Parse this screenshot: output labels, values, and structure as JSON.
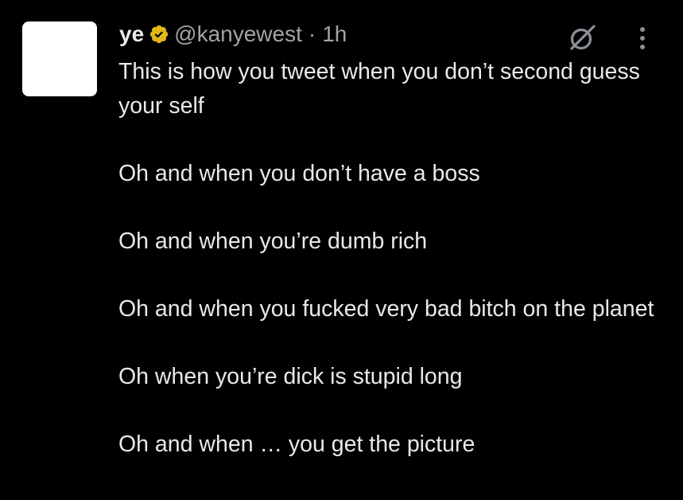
{
  "tweet": {
    "display_name": "ye",
    "handle": "@kanyewest",
    "separator": "·",
    "time": "1h",
    "paragraphs": [
      "This is how you tweet when you don’t second guess your self",
      "Oh and when you don’t have a boss",
      "Oh and when you’re dumb rich",
      "Oh and when you fucked very bad bitch on the planet",
      "Oh when you’re dick is stupid long",
      "Oh and when … you get the picture"
    ]
  },
  "icons": {
    "verified": "verified-badge-icon",
    "grok": "grok-icon",
    "more": "more-options-icon"
  },
  "colors": {
    "background": "#000000",
    "text": "#e7e9ea",
    "secondary_text": "#a0a4a8",
    "verified_badge": "#e2b719",
    "avatar": "#ffffff"
  }
}
